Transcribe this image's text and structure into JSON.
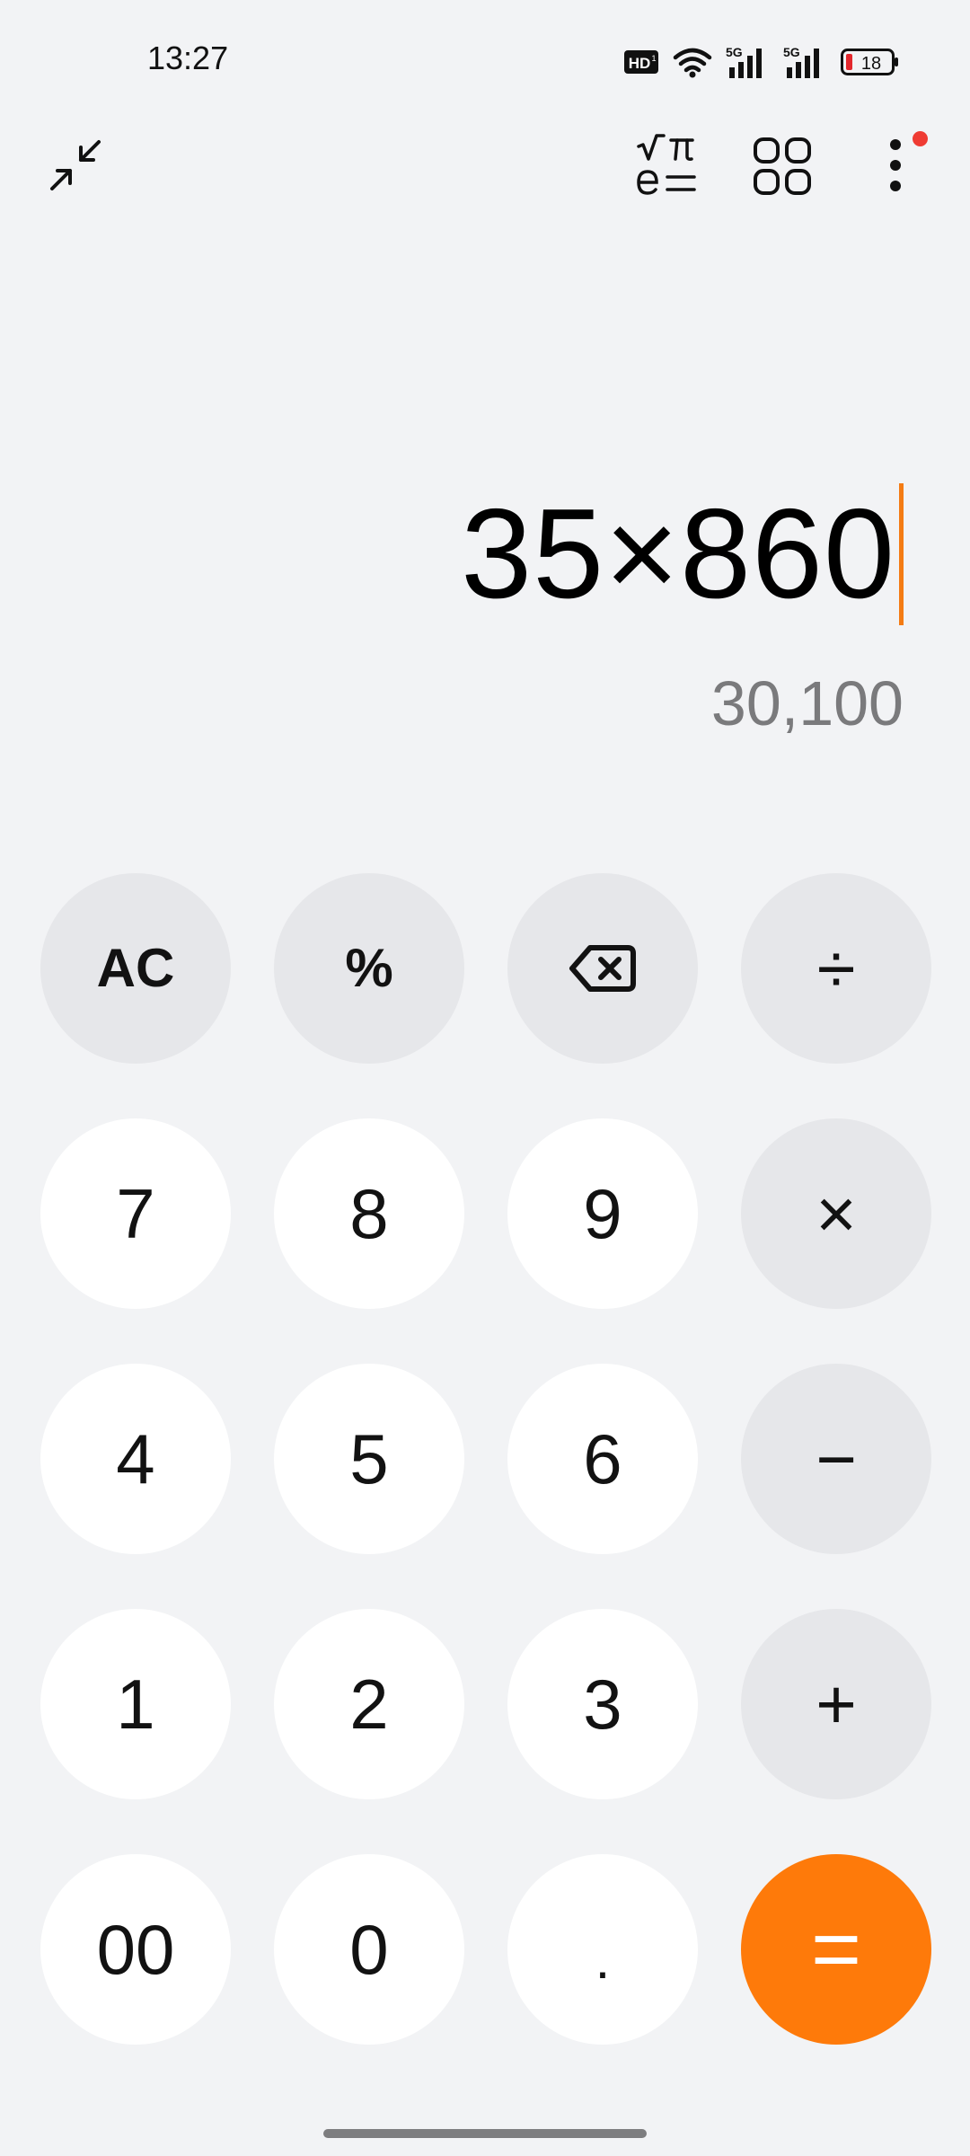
{
  "status_bar": {
    "time": "13:27",
    "network_badge": "HD",
    "signal_1_label": "5G",
    "signal_2_label": "5G",
    "battery_level": "18",
    "icons": [
      "hd-voice-icon",
      "wifi-icon",
      "signal-5g-icon",
      "signal-5g-icon",
      "battery-icon"
    ]
  },
  "toolbar": {
    "icons": [
      "collapse-icon",
      "scientific-mode-icon",
      "apps-grid-icon",
      "more-options-icon"
    ],
    "scientific_top": "√π",
    "scientific_bottom": "e="
  },
  "display": {
    "expression": "35×860",
    "result": "30,100"
  },
  "keypad": {
    "ac": "AC",
    "percent": "%",
    "backspace": "backspace-icon",
    "divide": "÷",
    "seven": "7",
    "eight": "8",
    "nine": "9",
    "multiply": "×",
    "four": "4",
    "five": "5",
    "six": "6",
    "minus": "−",
    "one": "1",
    "two": "2",
    "three": "3",
    "plus": "+",
    "double_zero": "00",
    "zero": "0",
    "decimal": ".",
    "equals": "="
  },
  "colors": {
    "background": "#f2f3f5",
    "number_key": "#ffffff",
    "function_key": "#e6e7ea",
    "accent": "#fe7a0a",
    "cursor": "#f47b13",
    "result_text": "#7a7a7c",
    "notification_dot": "#ef3b33"
  }
}
